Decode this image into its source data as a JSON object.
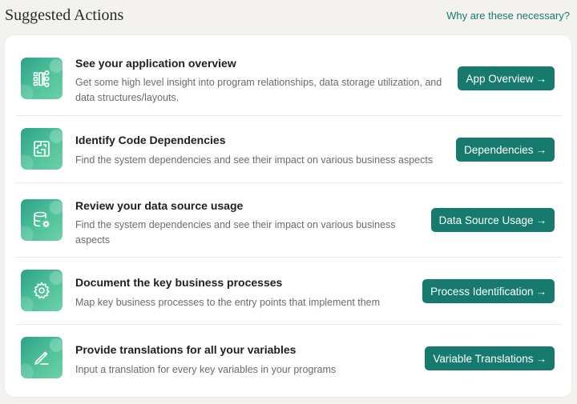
{
  "header": {
    "title": "Suggested Actions",
    "help_link": "Why are these necessary?"
  },
  "actions": [
    {
      "icon": "app-overview-icon",
      "title": "See your application overview",
      "description": "Get some high level insight into program relationships, data storage utilization, and data structures/layouts.",
      "button": "App Overview",
      "arrow": "→"
    },
    {
      "icon": "dependencies-icon",
      "title": "Identify Code Dependencies",
      "description": "Find the system dependencies and see their impact on various business aspects",
      "button": "Dependencies",
      "arrow": "→"
    },
    {
      "icon": "database-gear-icon",
      "title": "Review your data source usage",
      "description": "Find the system dependencies and see their impact on various business aspects",
      "button": "Data Source Usage",
      "arrow": "→"
    },
    {
      "icon": "gear-icon",
      "title": "Document the key business processes",
      "description": "Map key business processes to the entry points that implement them",
      "button": "Process Identification",
      "arrow": "→"
    },
    {
      "icon": "pen-icon",
      "title": "Provide translations for all your variables",
      "description": "Input a translation for every key variables in your programs",
      "button": "Variable Translations",
      "arrow": "→"
    }
  ],
  "colors": {
    "accent": "#177a6e",
    "link": "#18786f",
    "tile_start": "#2ea08a",
    "tile_end": "#6fd0a8",
    "background": "#f3f2ef"
  }
}
